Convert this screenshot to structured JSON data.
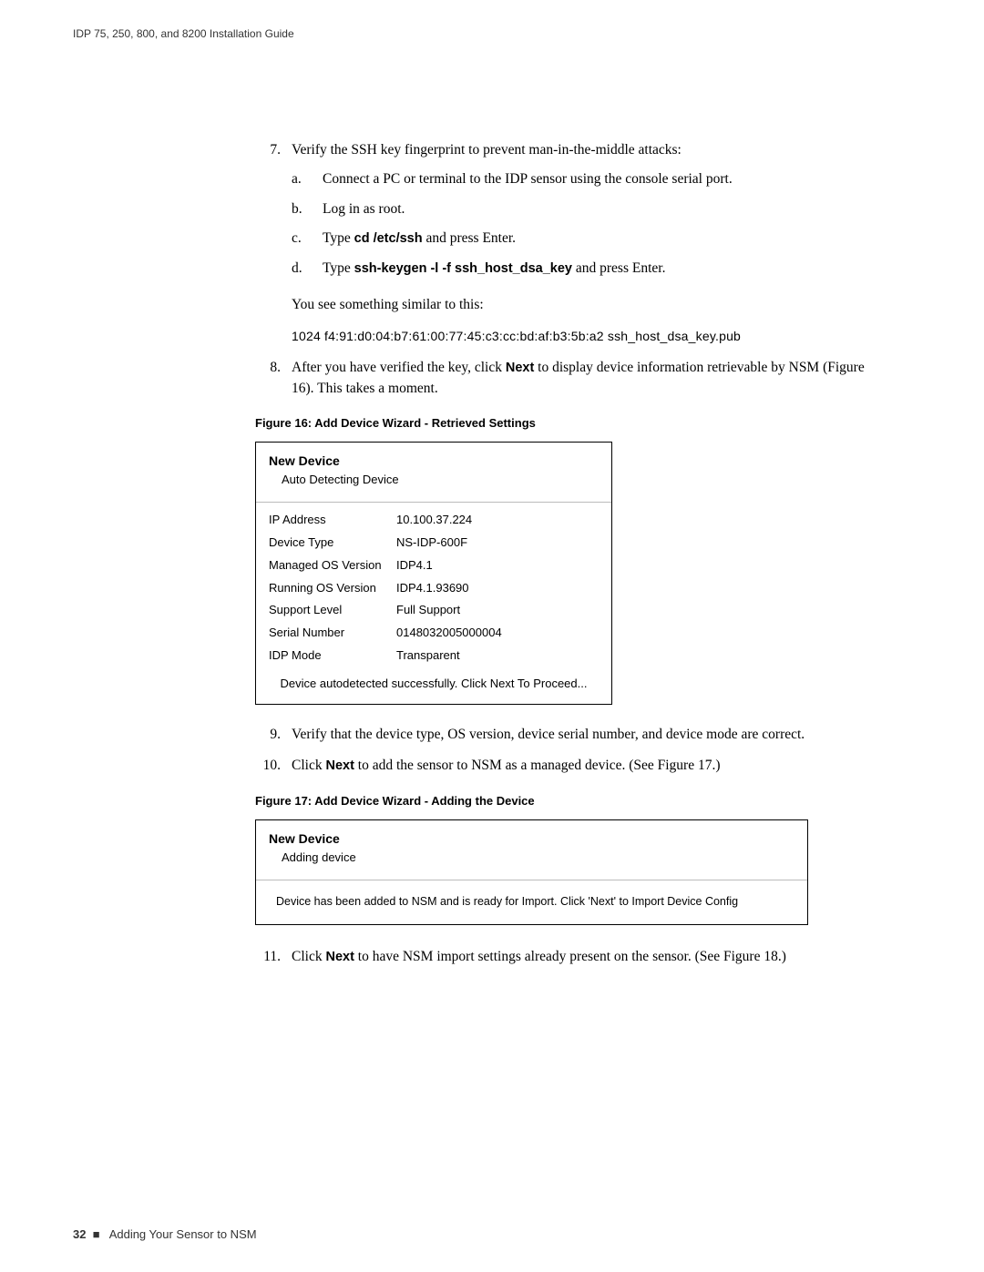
{
  "header": "IDP 75, 250, 800, and 8200 Installation Guide",
  "step7": {
    "num": "7.",
    "text": "Verify the SSH key fingerprint to prevent man-in-the-middle attacks:",
    "a": {
      "l": "a.",
      "t": "Connect a PC or terminal to the IDP sensor using the console serial port."
    },
    "b": {
      "l": "b.",
      "t": "Log in as root."
    },
    "c": {
      "l": "c.",
      "pre": "Type ",
      "cmd": "cd /etc/ssh",
      "post": " and press Enter."
    },
    "d": {
      "l": "d.",
      "pre": "Type ",
      "cmd": "ssh-keygen -l -f ssh_host_dsa_key",
      "post": " and press Enter."
    },
    "note": "You see something similar to this:",
    "output": "1024 f4:91:d0:04:b7:61:00:77:45:c3:cc:bd:af:b3:5b:a2 ssh_host_dsa_key.pub"
  },
  "step8": {
    "num": "8.",
    "pre": "After you have verified the key, click ",
    "bold": "Next",
    "post": " to display device information retrievable by NSM (Figure 16). This takes a moment."
  },
  "fig16": {
    "caption": "Figure 16:  Add Device Wizard - Retrieved Settings",
    "title": "New Device",
    "subtitle": "Auto Detecting Device",
    "rows": [
      {
        "k": "IP Address",
        "v": "10.100.37.224"
      },
      {
        "k": "Device Type",
        "v": "NS-IDP-600F"
      },
      {
        "k": "Managed OS Version",
        "v": "IDP4.1"
      },
      {
        "k": "Running OS Version",
        "v": "IDP4.1.93690"
      },
      {
        "k": "Support Level",
        "v": "Full Support"
      },
      {
        "k": "Serial Number",
        "v": "0148032005000004"
      },
      {
        "k": "IDP Mode",
        "v": "Transparent"
      }
    ],
    "footer": "Device autodetected successfully. Click Next To Proceed..."
  },
  "step9": {
    "num": "9.",
    "text": "Verify that the device type, OS version, device serial number, and device mode are correct."
  },
  "step10": {
    "num": "10.",
    "pre": "Click ",
    "bold": "Next",
    "post": " to add the sensor to NSM as a managed device. (See Figure 17.)"
  },
  "fig17": {
    "caption": "Figure 17:  Add Device Wizard - Adding the Device",
    "title": "New Device",
    "subtitle": "Adding device",
    "msg": "Device has been added to NSM and is ready for Import. Click 'Next' to Import Device Config"
  },
  "step11": {
    "num": "11.",
    "pre": "Click ",
    "bold": "Next",
    "post": " to have NSM import settings already present on the sensor. (See Figure 18.)"
  },
  "footer": {
    "page": "32",
    "sep": "■",
    "text": "Adding Your Sensor to NSM"
  }
}
